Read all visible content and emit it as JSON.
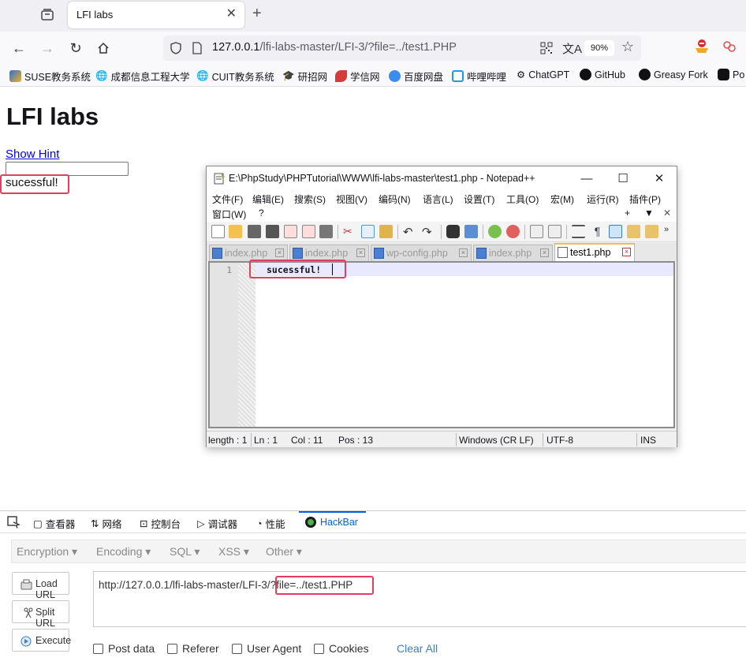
{
  "browser": {
    "tab_title": "LFI labs",
    "url_host": "127.0.0.1",
    "url_path": "/lfi-labs-master/LFI-3/?file=../test1.PHP",
    "zoom": "90%",
    "bookmarks": [
      "SUSE教务系统",
      "成都信息工程大学",
      "CUIT教务系统",
      "研招网",
      "学信网",
      "百度网盘",
      "哔哩哔哩",
      "ChatGPT",
      "GitHub",
      "Greasy Fork",
      "Po"
    ]
  },
  "page": {
    "title": "LFI labs",
    "hint_link": "Show Hint",
    "output": "sucessful!"
  },
  "npp": {
    "window_title": "E:\\PhpStudy\\PHPTutorial\\WWW\\lfi-labs-master\\test1.php - Notepad++",
    "menu": [
      "文件(F)",
      "编辑(E)",
      "搜索(S)",
      "视图(V)",
      "编码(N)",
      "语言(L)",
      "设置(T)",
      "工具(O)",
      "宏(M)",
      "运行(R)",
      "插件(P)",
      "窗口(W)",
      "?"
    ],
    "menu_right": [
      "+",
      "▼",
      "✕"
    ],
    "tabs": [
      "index.php",
      "index.php",
      "wp-config.php",
      "index.php",
      "test1.php"
    ],
    "line_number": "1",
    "code": "sucessful!",
    "status": {
      "length": "length : 1",
      "ln": "Ln : 1",
      "col": "Col : 11",
      "pos": "Pos : 13",
      "eol": "Windows (CR LF)",
      "encoding": "UTF-8",
      "mode": "INS"
    }
  },
  "devtools": {
    "tabs": [
      "查看器",
      "网络",
      "控制台",
      "调试器",
      "性能",
      "HackBar"
    ],
    "active_tab": "HackBar"
  },
  "hackbar": {
    "menus": [
      "Encryption",
      "Encoding",
      "SQL",
      "XSS",
      "Other"
    ],
    "buttons": [
      "Load URL",
      "Split URL",
      "Execute"
    ],
    "url_prefix": "http://127.0.0.1/lfi-labs-master/LFI-3/",
    "url_query": "?file=../test1.PHP",
    "options": [
      "Post data",
      "Referer",
      "User Agent",
      "Cookies"
    ],
    "clear_all": "Clear All"
  },
  "colors": {
    "highlight_box": "#e04060",
    "link": "#0000ee",
    "devtools_accent": "#0060df"
  }
}
